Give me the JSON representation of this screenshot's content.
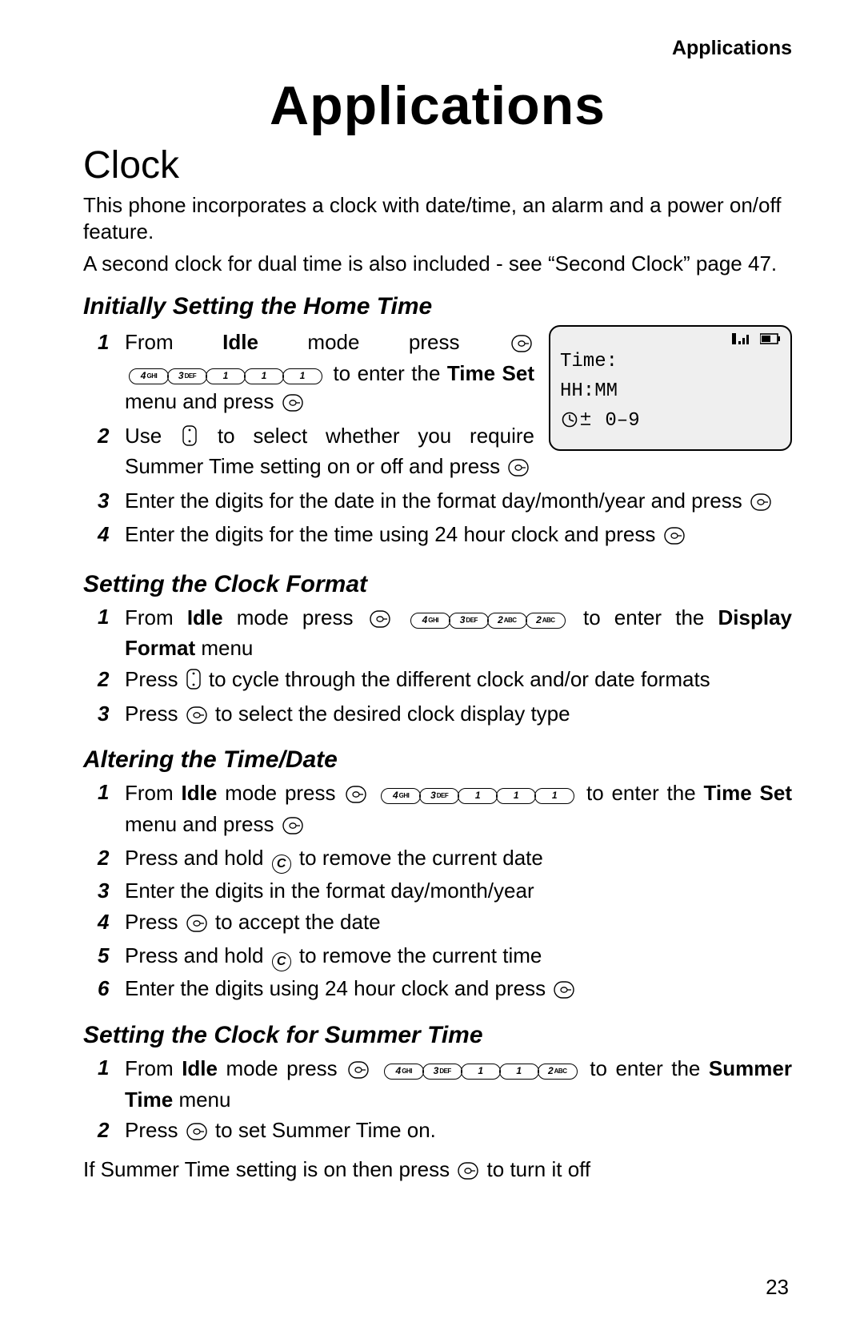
{
  "header": {
    "running": "Applications"
  },
  "title": "Applications",
  "section": "Clock",
  "intro": [
    "This phone incorporates a clock with date/time, an alarm and a power on/off feature.",
    "A second clock for dual time is also included - see “Second Clock” page 47."
  ],
  "keys": {
    "four": "4",
    "four_sub": "GHI",
    "three": "3",
    "three_sub": "DEF",
    "two": "2",
    "two_sub": "ABC",
    "one": "1",
    "cancel": "C"
  },
  "screen": {
    "line1": "Time:",
    "line2": "HH:MM",
    "line3_suffix": " 0–9"
  },
  "sub1": {
    "title": "Initially Setting the Home Time",
    "s1a": "From ",
    "s1_idle": "Idle",
    "s1b": " mode press ",
    "s1c": " to enter the ",
    "s1_timeset": "Time Set",
    "s1d": " menu and press ",
    "s2a": "Use ",
    "s2b": " to select whether you require Summer Time setting on or off and press ",
    "s3": "Enter the digits for the date in the format day/month/year and press ",
    "s4": "Enter the digits for the time using 24 hour clock and press "
  },
  "sub2": {
    "title": "Setting the Clock Format",
    "s1a": "From ",
    "s1b": " mode press ",
    "s1c": " to enter the ",
    "s1_df": "Display Format",
    "s1d": " menu",
    "s2a": "Press ",
    "s2b": " to cycle through the different clock and/or date formats",
    "s3a": "Press ",
    "s3b": " to select the desired clock display type"
  },
  "sub3": {
    "title": "Altering the Time/Date",
    "s1a": "From ",
    "s1b": " mode press ",
    "s1c": " to enter the ",
    "s1d": " menu and press ",
    "s2a": "Press and hold ",
    "s2b": " to remove the current date",
    "s3": "Enter the digits in the format day/month/year",
    "s4a": "Press ",
    "s4b": " to accept the date",
    "s5a": "Press and hold ",
    "s5b": " to remove the current time",
    "s6": "Enter the digits using 24 hour clock and press "
  },
  "sub4": {
    "title": "Setting the Clock for Summer Time",
    "s1a": "From ",
    "s1b": " mode press ",
    "s1c": " to enter the ",
    "s1_st": "Summer Time",
    "s1d": " menu",
    "s2a": "Press ",
    "s2b": " to set Summer Time on.",
    "note_a": "If Summer Time setting is on then press ",
    "note_b": " to turn it off"
  },
  "page_number": "23",
  "nums": {
    "n1": "1",
    "n2": "2",
    "n3": "3",
    "n4": "4",
    "n5": "5",
    "n6": "6"
  }
}
